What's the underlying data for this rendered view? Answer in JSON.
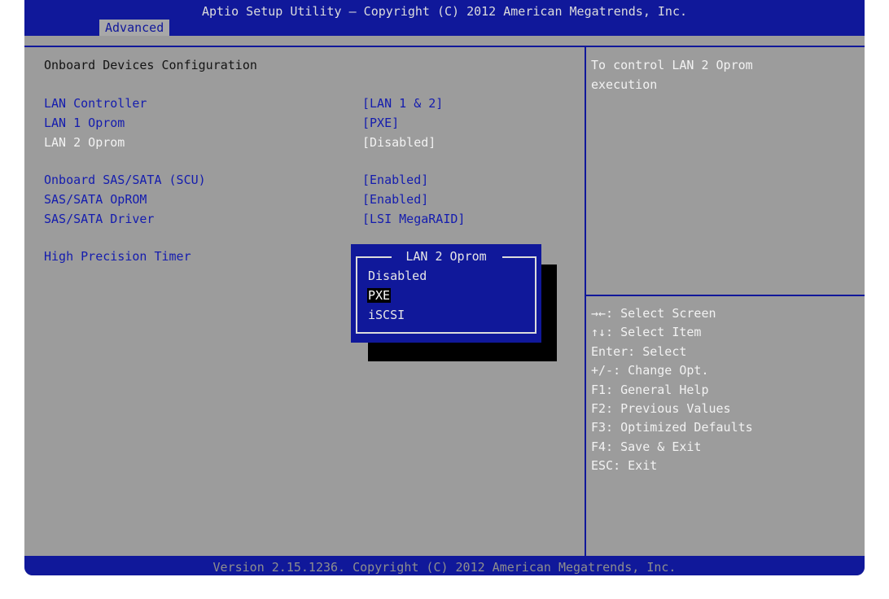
{
  "header": {
    "title": "Aptio Setup Utility – Copyright (C) 2012 American Megatrends, Inc.",
    "active_tab": "Advanced"
  },
  "main": {
    "section_title": "Onboard Devices Configuration",
    "items": [
      {
        "label": "LAN Controller",
        "value": "[LAN 1 & 2]"
      },
      {
        "label": "LAN 1 Oprom",
        "value": "[PXE]"
      },
      {
        "label": "LAN 2 Oprom",
        "value": "[Disabled]"
      },
      {
        "label": "Onboard SAS/SATA (SCU)",
        "value": "[Enabled]"
      },
      {
        "label": "SAS/SATA OpROM",
        "value": "[Enabled]"
      },
      {
        "label": "SAS/SATA Driver",
        "value": "[LSI MegaRAID]"
      },
      {
        "label": "High Precision Timer",
        "value": ""
      }
    ],
    "selected_item": "LAN 2 Oprom"
  },
  "help": {
    "line1": "To control LAN 2 Oprom",
    "line2": "execution"
  },
  "keys": [
    "→←: Select Screen",
    "↑↓: Select Item",
    "Enter: Select",
    "+/-: Change Opt.",
    "F1: General Help",
    "F2: Previous Values",
    "F3: Optimized Defaults",
    "F4: Save & Exit",
    "ESC: Exit"
  ],
  "popup": {
    "title": "LAN 2 Oprom",
    "options": [
      "Disabled",
      "PXE",
      "iSCSI"
    ],
    "highlighted": "PXE"
  },
  "footer": {
    "text": "Version 2.15.1236. Copyright (C) 2012 American Megatrends, Inc."
  },
  "colors": {
    "bios_blue": "#10189a",
    "panel_gray": "#9c9c9c",
    "label_blue": "#141cae",
    "highlight_white": "#f2f2f2"
  }
}
